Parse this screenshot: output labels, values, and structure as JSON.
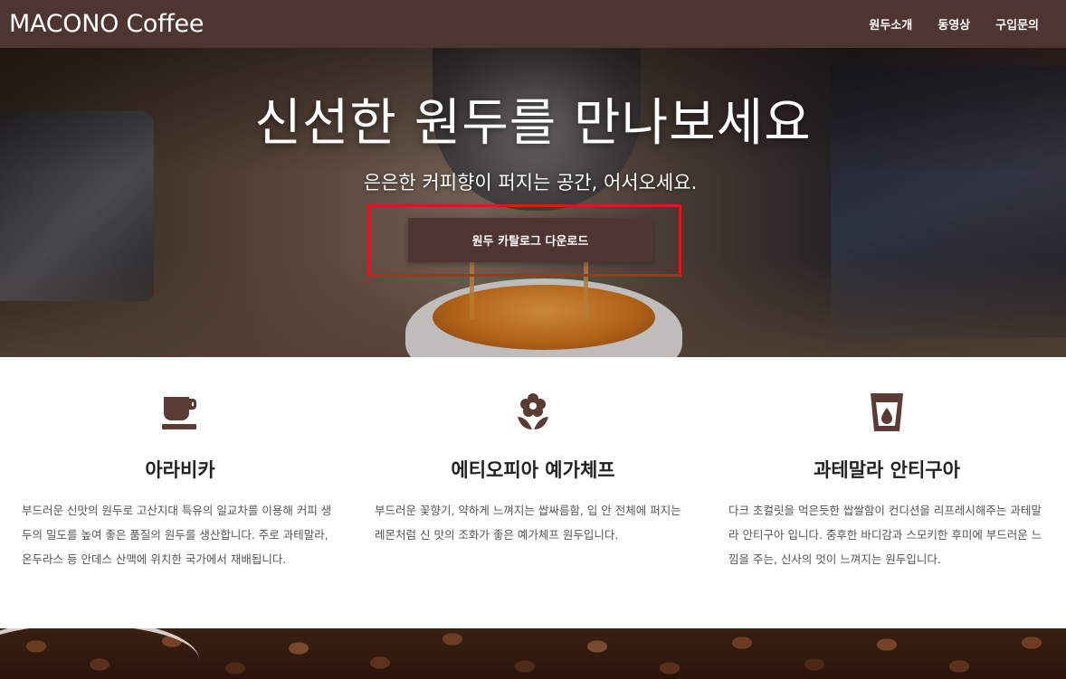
{
  "brand": "MACONO Coffee",
  "nav": [
    {
      "label": "원두소개"
    },
    {
      "label": "동영상"
    },
    {
      "label": "구입문의"
    }
  ],
  "hero": {
    "title": "신선한 원두를 만나보세요",
    "subtitle": "은은한 커피향이 퍼지는 공간, 어서오세요.",
    "button_label": "원두 카탈로그 다운로드"
  },
  "features": [
    {
      "icon": "coffee-cup-icon",
      "title": "아라비카",
      "text": "부드러운 신맛의 원두로 고산지대 특유의 일교차를 이용해 커피 생두의 밀도를 높여 좋은 품질의 원두를 생산합니다. 주로 과테말라, 온두라스 등 안데스 산맥에 위치한 국가에서 재배됩니다."
    },
    {
      "icon": "flower-icon",
      "title": "에티오피아 예가체프",
      "text": "부드러운 꽃향기, 약하게 느껴지는 쌉싸름함, 입 안 전체에 퍼지는 레몬처럼 신 맛의 조화가 좋은 예가체프 원두입니다."
    },
    {
      "icon": "glass-drop-icon",
      "title": "과테말라 안티구아",
      "text": "다크 초컬릿을 먹은듯한 쌉쌀함이 컨디션을 리프레시해주는 과테말라 안티구아 입니다. 중후한 바디감과 스모키한 후미에 부드러운 느낌을 주는, 신사의 멋이 느껴지는 원두입니다."
    }
  ],
  "colors": {
    "brand_brown": "#4e3531",
    "highlight_red": "#e0161e"
  }
}
